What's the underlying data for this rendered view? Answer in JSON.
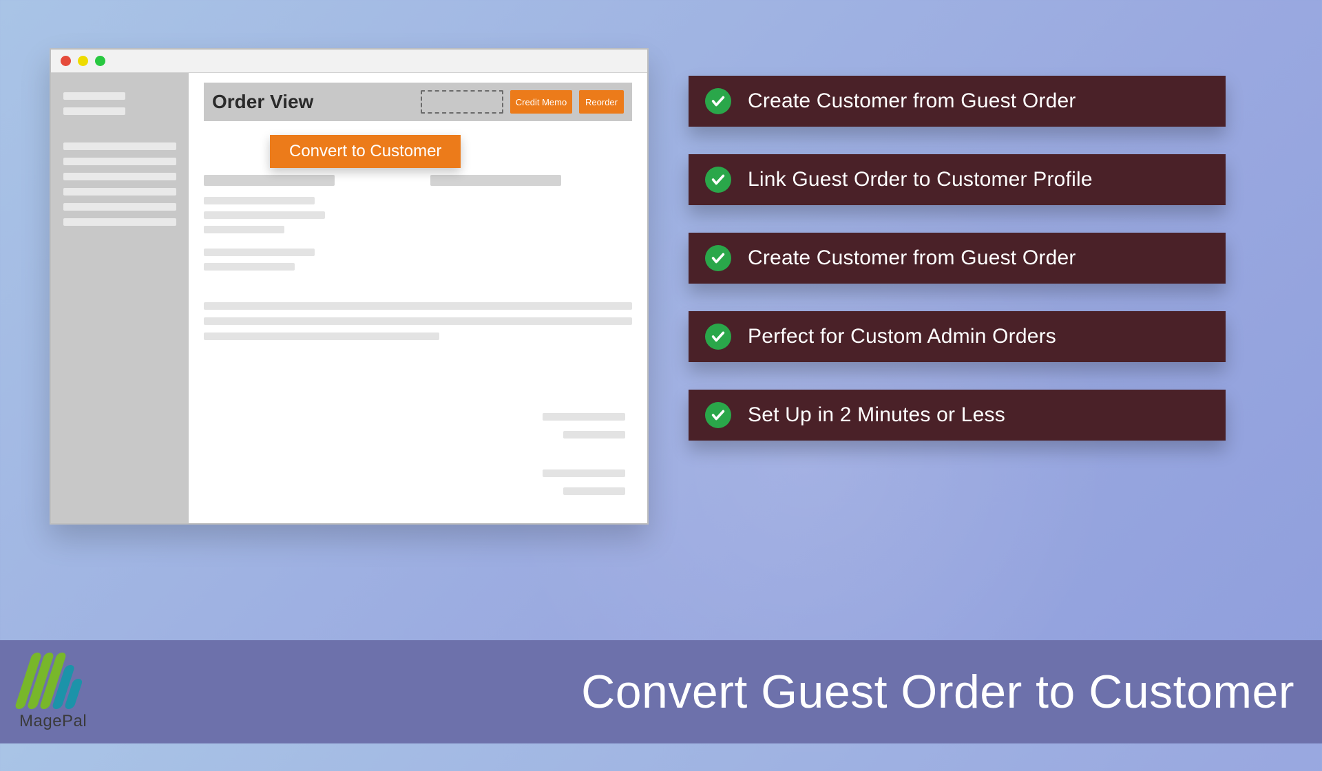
{
  "window": {
    "title": "Order View",
    "toolbar": {
      "credit_memo_label": "Credit Memo",
      "reorder_label": "Reorder"
    },
    "cta_label": "Convert to Customer"
  },
  "features": [
    "Create Customer from Guest Order",
    "Link Guest Order to Customer Profile",
    "Create Customer from Guest Order",
    "Perfect for Custom Admin Orders",
    "Set Up in 2 Minutes or Less"
  ],
  "footer": {
    "brand": "MagePal",
    "headline": "Convert Guest Order to Customer"
  },
  "colors": {
    "accent": "#ec7b1a",
    "feature_bg": "#4a2128",
    "check_bg": "#2aa74a",
    "footer_bg": "#6d71ab"
  }
}
